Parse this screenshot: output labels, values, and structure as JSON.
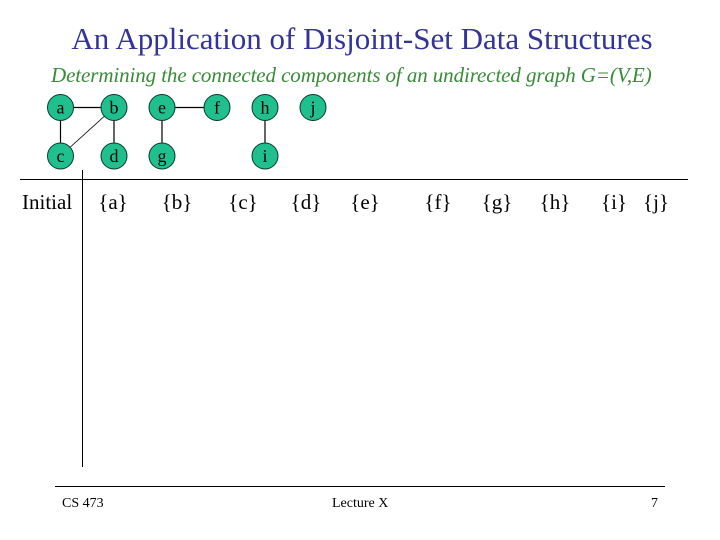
{
  "slide": {
    "title": "An Application of Disjoint-Set Data Structures",
    "subtitle": "Determining the connected components of an undirected graph G=(V,E)",
    "colors": {
      "title": "#333399",
      "subtitle": "#3a8a3a",
      "node_fill": "#20c08e"
    }
  },
  "graph": {
    "nodes": [
      {
        "id": "a",
        "label": "a"
      },
      {
        "id": "b",
        "label": "b"
      },
      {
        "id": "c",
        "label": "c"
      },
      {
        "id": "d",
        "label": "d"
      },
      {
        "id": "e",
        "label": "e"
      },
      {
        "id": "f",
        "label": "f"
      },
      {
        "id": "g",
        "label": "g"
      },
      {
        "id": "h",
        "label": "h"
      },
      {
        "id": "i",
        "label": "i"
      },
      {
        "id": "j",
        "label": "j"
      }
    ],
    "edges": [
      [
        "a",
        "b"
      ],
      [
        "a",
        "c"
      ],
      [
        "b",
        "c"
      ],
      [
        "b",
        "d"
      ],
      [
        "e",
        "f"
      ],
      [
        "e",
        "g"
      ],
      [
        "h",
        "i"
      ]
    ]
  },
  "table": {
    "row_label": "Initial",
    "sets": [
      "{a}",
      "{b}",
      "{c}",
      "{d}",
      "{e}",
      "{f}",
      "{g}",
      "{h}",
      "{i}",
      "{j}"
    ]
  },
  "footer": {
    "left": "CS 473",
    "center": "Lecture X",
    "right": "7"
  }
}
